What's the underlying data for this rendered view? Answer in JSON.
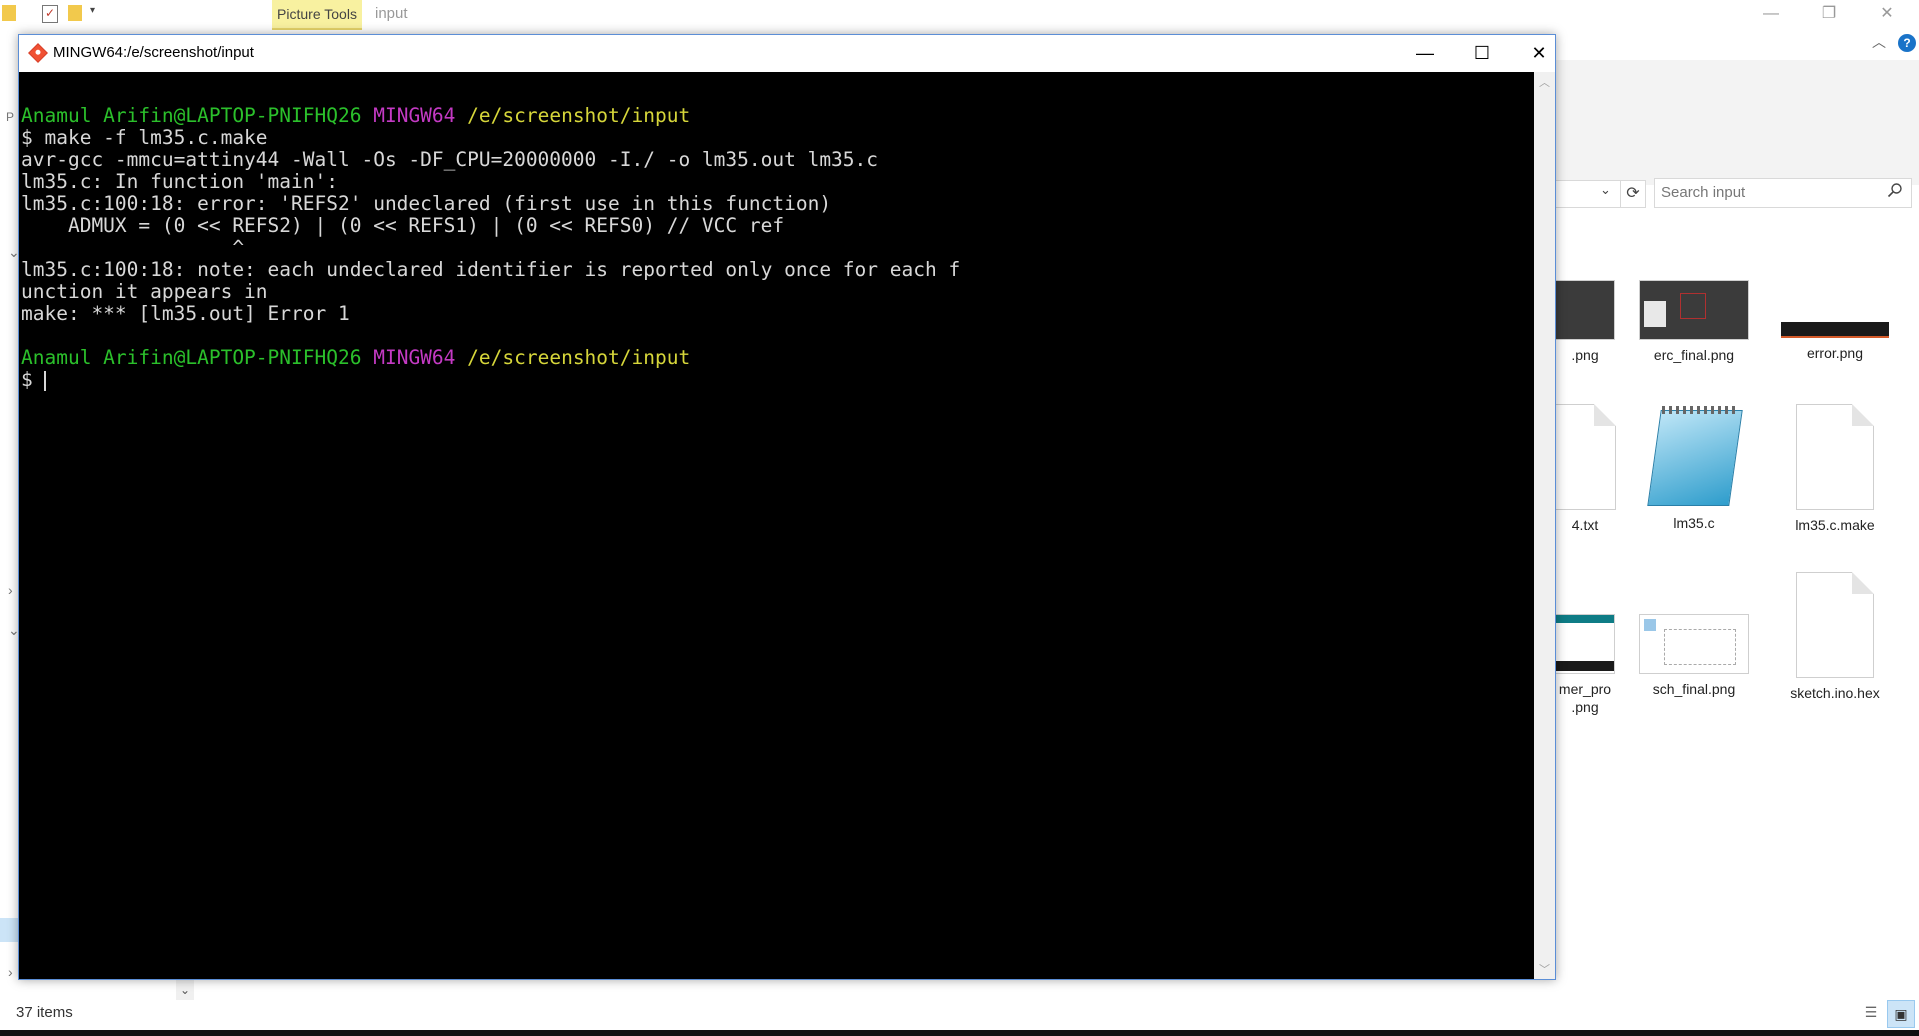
{
  "explorer": {
    "ribbon": {
      "contextual_tab": "Picture Tools",
      "window_title": "input"
    },
    "search": {
      "placeholder": "Search input"
    },
    "files": [
      {
        "name": ".png",
        "kind": "image-dark"
      },
      {
        "name": "erc_final.png",
        "kind": "image-dark"
      },
      {
        "name": "error.png",
        "kind": "image-strip"
      },
      {
        "name": "4.txt",
        "kind": "doc"
      },
      {
        "name": "lm35.c",
        "kind": "notepad"
      },
      {
        "name": "lm35.c.make",
        "kind": "doc"
      },
      {
        "name": "mer_pro\n.png",
        "kind": "image-teal"
      },
      {
        "name": "sch_final.png",
        "kind": "image-schematic"
      },
      {
        "name": "sketch.ino.hex",
        "kind": "doc"
      }
    ],
    "status": {
      "items_count": "37 items"
    }
  },
  "terminal": {
    "title": "MINGW64:/e/screenshot/input",
    "prompt1": {
      "user": "Anamul Arifin@LAPTOP-PNIFHQ26",
      "env": "MINGW64",
      "path": "/e/screenshot/input"
    },
    "output_lines": [
      "$ make -f lm35.c.make",
      "avr-gcc -mmcu=attiny44 -Wall -Os -DF_CPU=20000000 -I./ -o lm35.out lm35.c",
      "lm35.c: In function 'main':",
      "lm35.c:100:18: error: 'REFS2' undeclared (first use in this function)",
      "    ADMUX = (0 << REFS2) | (0 << REFS1) | (0 << REFS0) // VCC ref",
      "                  ^",
      "lm35.c:100:18: note: each undeclared identifier is reported only once for each f",
      "unction it appears in",
      "make: *** [lm35.out] Error 1"
    ],
    "prompt2": {
      "user": "Anamul Arifin@LAPTOP-PNIFHQ26",
      "env": "MINGW64",
      "path": "/e/screenshot/input"
    },
    "input_prefix": "$ "
  }
}
